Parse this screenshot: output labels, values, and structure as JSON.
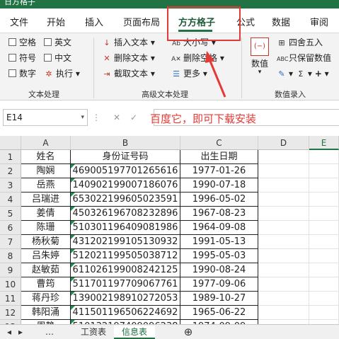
{
  "app": {
    "title_fragment": "日方格子"
  },
  "tabs": [
    "文件",
    "开始",
    "插入",
    "页面布局",
    "方方格子",
    "公式",
    "数据",
    "审阅"
  ],
  "active_tab": "方方格子",
  "ribbon": {
    "text_group": {
      "checkboxes": [
        "空格",
        "英文",
        "符号",
        "中文",
        "数字"
      ],
      "exec_label": "执行",
      "label": "文本处理"
    },
    "advanced_group": {
      "insert_text": "插入文本",
      "delete_text": "删除文本",
      "extract_text": "截取文本",
      "case_label": "大小写",
      "delete_space": "删除空格",
      "more_label": "更多",
      "label": "高级文本处理"
    },
    "number_group": {
      "big_button": "数值",
      "round_label": "四舍五入",
      "keep_value": "只保留数值",
      "label": "数值录入"
    }
  },
  "annotation": "百度它，即可下载安装",
  "formula_bar": {
    "name_box": "E14",
    "formula": ""
  },
  "columns": [
    "A",
    "B",
    "C",
    "D",
    "E"
  ],
  "rows": [
    {
      "n": "1",
      "a": "姓名",
      "b": "身份证号码",
      "c": "出生日期"
    },
    {
      "n": "2",
      "a": "陶娴",
      "b": "469005197701265616",
      "c": "1977-01-26"
    },
    {
      "n": "3",
      "a": "岳燕",
      "b": "140902199007186076",
      "c": "1990-07-18"
    },
    {
      "n": "4",
      "a": "吕瑞进",
      "b": "653022199605023591",
      "c": "1996-05-02"
    },
    {
      "n": "5",
      "a": "姜倩",
      "b": "450326196708232896",
      "c": "1967-08-23"
    },
    {
      "n": "6",
      "a": "陈珊",
      "b": "510301196409081986",
      "c": "1964-09-08"
    },
    {
      "n": "7",
      "a": "杨秋菊",
      "b": "431202199105130932",
      "c": "1991-05-13"
    },
    {
      "n": "8",
      "a": "吕朱婷",
      "b": "512021199505038712",
      "c": "1995-05-03"
    },
    {
      "n": "9",
      "a": "赵敏茹",
      "b": "611026199008242125",
      "c": "1990-08-24"
    },
    {
      "n": "10",
      "a": "曹筠",
      "b": "511701197709067761",
      "c": "1977-09-06"
    },
    {
      "n": "11",
      "a": "蒋丹珍",
      "b": "139002198910272053",
      "c": "1989-10-27"
    },
    {
      "n": "12",
      "a": "韩阳涌",
      "b": "411501196506224692",
      "c": "1965-06-22"
    },
    {
      "n": "13",
      "a": "周静",
      "b": "510132197409096238",
      "c": "1974-09-09"
    }
  ],
  "sheet_tabs": [
    "工资表",
    "信息表"
  ],
  "active_sheet": "信息表",
  "colors": {
    "excel_green": "#217346",
    "annotation_red": "#e53935"
  }
}
